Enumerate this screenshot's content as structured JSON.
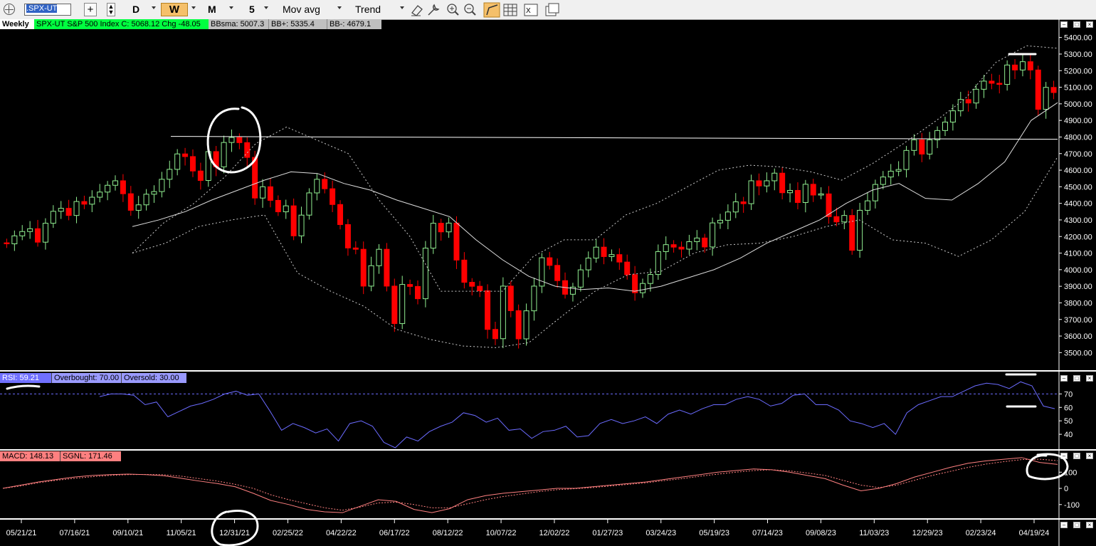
{
  "toolbar": {
    "symbol": ".SPX-UT",
    "periods": [
      "D",
      "W",
      "M"
    ],
    "active_period": "W",
    "count": "5",
    "indicator": "Mov avg",
    "draw_tool": "Trend",
    "icons": [
      "crosshair-icon",
      "add-icon",
      "scroll-icon",
      "eraser-icon",
      "wrench-icon",
      "zoom-in-icon",
      "zoom-out-icon",
      "line-icon",
      "grid-icon",
      "excel-icon",
      "windows-icon"
    ]
  },
  "price_panel": {
    "interval": "Weekly",
    "header": "SPX-UT  S&P 500 Index  C: 5068.12  Chg -48.05",
    "bbsma": "BBsma: 5007.3",
    "bbplus": "BB+: 5335.4",
    "bbminus": "BB-: 4679.1",
    "y_ticks": [
      "5400.00",
      "5300.00",
      "5200.00",
      "5100.00",
      "5000.00",
      "4900.00",
      "4800.00",
      "4700.00",
      "4600.00",
      "4500.00",
      "4400.00",
      "4300.00",
      "4200.00",
      "4100.00",
      "4000.00",
      "3900.00",
      "3800.00",
      "3700.00",
      "3600.00",
      "3500.00"
    ]
  },
  "rsi_panel": {
    "rsi": "RSI: 59.21",
    "overbought": "Overbought: 70.00",
    "oversold": "Oversold: 30.00",
    "y_ticks": [
      "70",
      "60",
      "50",
      "40"
    ]
  },
  "macd_panel": {
    "macd": "MACD: 148.13",
    "signal": "SGNL: 171.46",
    "y_ticks": [
      "100",
      "0",
      "-100"
    ]
  },
  "x_axis": [
    "05/21/21",
    "07/16/21",
    "09/10/21",
    "11/05/21",
    "12/31/21",
    "02/25/22",
    "04/22/22",
    "06/17/22",
    "08/12/22",
    "10/07/22",
    "12/02/22",
    "01/27/23",
    "03/24/23",
    "05/19/23",
    "07/14/23",
    "09/08/23",
    "11/03/23",
    "12/29/23",
    "02/23/24",
    "04/19/24"
  ],
  "colors": {
    "up": "#90ee90",
    "down": "#ff0000",
    "rsi": "#6b6bff",
    "macd": "#ff8080",
    "label_green": "#00ff40",
    "label_blue": "#7070ff",
    "label_red": "#ff8080"
  },
  "chart_data": {
    "type": "candlestick",
    "x_start": "05/21/21",
    "x_end": "04/26/24",
    "closes": [
      4156,
      4204,
      4230,
      4247,
      4166,
      4280,
      4352,
      4370,
      4327,
      4411,
      4395,
      4437,
      4468,
      4509,
      4536,
      4458,
      4358,
      4391,
      4455,
      4471,
      4545,
      4605,
      4698,
      4682,
      4595,
      4538,
      4712,
      4620,
      4767,
      4797,
      4766,
      4677,
      4432,
      4500,
      4418,
      4349,
      4385,
      4204,
      4329,
      4463,
      4545,
      4488,
      4393,
      4272,
      4131,
      4123,
      3901,
      4024,
      4123,
      3901,
      3675,
      3911,
      3899,
      3825,
      4130,
      4280,
      4228,
      4281,
      4058,
      3924,
      3900,
      3873,
      3640,
      3584,
      3901,
      3753,
      3583,
      3752,
      3901,
      4072,
      4026,
      3934,
      3852,
      3895,
      3999,
      4070,
      4136,
      4079,
      4091,
      4046,
      3970,
      3861,
      3917,
      3971,
      4109,
      4151,
      4136,
      4124,
      4169,
      4191,
      4137,
      4282,
      4298,
      4348,
      4409,
      4398,
      4536,
      4505,
      4536,
      4582,
      4464,
      4478,
      4405,
      4515,
      4450,
      4457,
      4320,
      4288,
      4327,
      4117,
      4358,
      4415,
      4514,
      4559,
      4594,
      4604,
      4719,
      4783,
      4697,
      4783,
      4839,
      4890,
      4958,
      5026,
      5005,
      5088,
      5137,
      5124,
      5117,
      5234,
      5204,
      5254,
      5204,
      4967,
      5099,
      5068
    ],
    "bb_mid_series": [
      4260,
      4300,
      4350,
      4420,
      4480,
      4540,
      4590,
      4580,
      4520,
      4480,
      4420,
      4370,
      4320,
      4180,
      4060,
      3960,
      3900,
      3880,
      3890,
      3870,
      3900,
      3950,
      4000,
      4070,
      4160,
      4230,
      4300,
      4400,
      4480,
      4520,
      4430,
      4420,
      4520,
      4650,
      4900,
      5007
    ],
    "bb_upper_series": [
      4100,
      4280,
      4400,
      4560,
      4760,
      4860,
      4780,
      4700,
      4420,
      4200,
      3870,
      3870,
      3870,
      4080,
      4180,
      4180,
      4330,
      4400,
      4500,
      4600,
      4630,
      4620,
      4590,
      4540,
      4640,
      4760,
      4890,
      5030,
      5250,
      5350,
      5335
    ],
    "bb_lower_series": [
      4100,
      4160,
      4260,
      4300,
      4330,
      3980,
      3870,
      3780,
      3640,
      3580,
      3540,
      3530,
      3560,
      3720,
      3870,
      3970,
      3990,
      4100,
      4150,
      4160,
      4200,
      4260,
      4300,
      4180,
      4160,
      4080,
      4180,
      4350,
      4680
    ],
    "horizontal_line": 4795,
    "rsi_series": [
      68,
      70,
      70,
      69,
      62,
      64,
      53,
      57,
      61,
      63,
      66,
      70,
      72,
      69,
      70,
      57,
      43,
      48,
      45,
      41,
      44,
      35,
      48,
      50,
      46,
      34,
      30,
      38,
      35,
      42,
      46,
      49,
      56,
      54,
      49,
      52,
      43,
      44,
      37,
      42,
      43,
      46,
      38,
      39,
      48,
      51,
      48,
      50,
      53,
      48,
      55,
      58,
      55,
      59,
      62,
      62,
      66,
      68,
      66,
      61,
      63,
      69,
      70,
      62,
      62,
      58,
      50,
      48,
      45,
      48,
      40,
      56,
      62,
      65,
      68,
      68,
      72,
      76,
      78,
      77,
      74,
      79,
      76,
      61,
      59
    ],
    "macd_series": [
      0,
      20,
      40,
      55,
      70,
      80,
      85,
      88,
      85,
      78,
      62,
      45,
      30,
      10,
      -30,
      -75,
      -100,
      -130,
      -145,
      -150,
      -110,
      -70,
      -80,
      -130,
      -150,
      -125,
      -70,
      -45,
      -30,
      -20,
      -10,
      0,
      0,
      10,
      20,
      30,
      40,
      55,
      70,
      85,
      100,
      110,
      120,
      115,
      100,
      80,
      60,
      20,
      -15,
      0,
      30,
      70,
      100,
      130,
      155,
      170,
      180,
      190,
      160,
      148
    ],
    "signal_series": [
      0,
      15,
      35,
      50,
      62,
      72,
      80,
      85,
      86,
      84,
      75,
      60,
      45,
      25,
      0,
      -40,
      -70,
      -95,
      -120,
      -135,
      -115,
      -90,
      -85,
      -100,
      -120,
      -120,
      -95,
      -70,
      -50,
      -35,
      -20,
      -8,
      -2,
      5,
      15,
      25,
      35,
      48,
      60,
      75,
      88,
      100,
      110,
      115,
      108,
      95,
      80,
      50,
      20,
      5,
      20,
      50,
      80,
      105,
      130,
      150,
      165,
      178,
      180,
      171
    ],
    "ylim_price": [
      3450,
      5450
    ],
    "ylim_rsi": [
      30,
      85
    ],
    "ylim_macd": [
      -180,
      220
    ]
  }
}
